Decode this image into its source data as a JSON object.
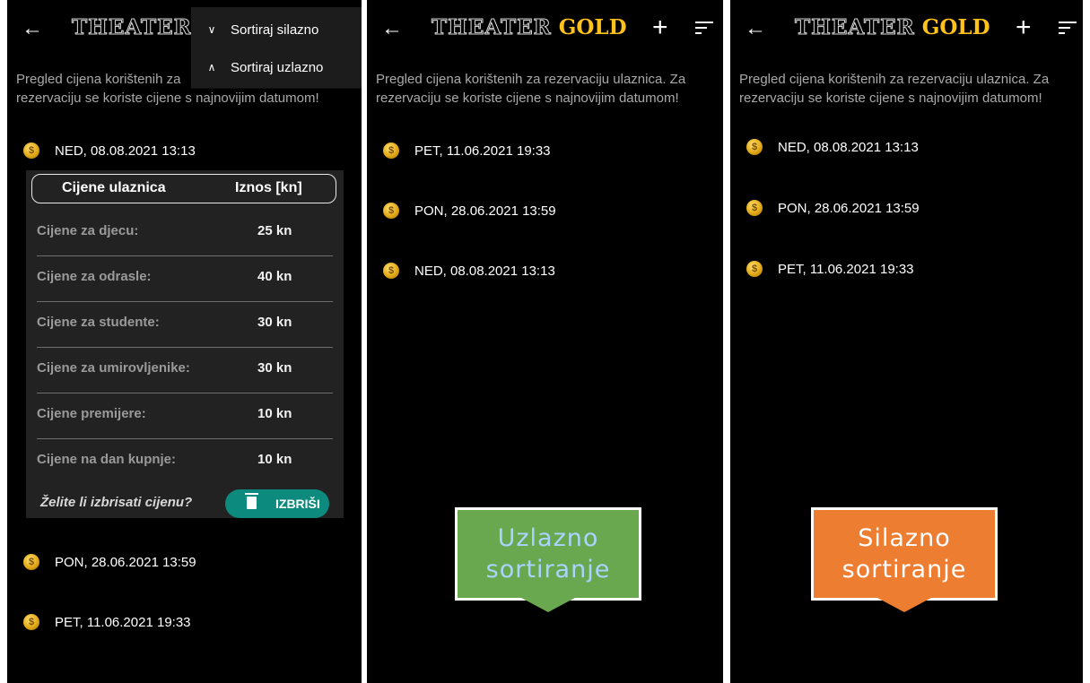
{
  "app": {
    "logo_outline": "THEATER",
    "logo_gold": "GOLD",
    "description": "Pregled cijena korištenih za rezervaciju ulaznica. Za rezervaciju se koriste cijene s najnovijim datumom!",
    "description_short": "Pregled cijena korištenih za",
    "description_line2": "rezervaciju se koriste cijene s najnovijim datumom!"
  },
  "icons": {
    "back": "arrow-left-icon",
    "add": "plus-icon",
    "sort": "sort-icon",
    "coin": "coin-icon",
    "delete": "trash-icon"
  },
  "colors": {
    "background": "#000000",
    "gold": "#ffc21a",
    "delete_button": "#0c8a7d",
    "ascending_callout": "#6aa84f",
    "descending_callout": "#ed7d31"
  },
  "panel1": {
    "menu": {
      "items": [
        {
          "label": "Sortiraj silazno",
          "icon": "chevron-down-icon"
        },
        {
          "label": "Sortiraj uzlazno",
          "icon": "chevron-up-icon"
        }
      ]
    },
    "entries": [
      {
        "label": "NED, 08.08.2021 13:13",
        "expanded": true
      },
      {
        "label": "PON, 28.06.2021 13:59"
      },
      {
        "label": "PET, 11.06.2021 19:33"
      }
    ],
    "card": {
      "col_category": "Cijene ulaznica",
      "col_amount": "Iznos [kn]",
      "rows": [
        {
          "label": "Cijene za djecu:",
          "value": "25 kn"
        },
        {
          "label": "Cijene za odrasle:",
          "value": "40 kn"
        },
        {
          "label": "Cijene za studente:",
          "value": "30 kn"
        },
        {
          "label": "Cijene za umirovljenike:",
          "value": "30 kn"
        },
        {
          "label": "Cijene premijere:",
          "value": "10 kn"
        },
        {
          "label": "Cijene na dan kupnje:",
          "value": "10 kn"
        }
      ],
      "delete_prompt": "Želite li izbrisati cijenu?",
      "delete_label": "IZBRIŠI"
    }
  },
  "panel2": {
    "entries": [
      {
        "label": "PET, 11.06.2021 19:33"
      },
      {
        "label": "PON, 28.06.2021 13:59"
      },
      {
        "label": "NED, 08.08.2021 13:13"
      }
    ],
    "callout": {
      "line1": "Uzlazno",
      "line2": "sortiranje"
    }
  },
  "panel3": {
    "entries": [
      {
        "label": "NED, 08.08.2021 13:13"
      },
      {
        "label": "PON, 28.06.2021 13:59"
      },
      {
        "label": "PET, 11.06.2021 19:33"
      }
    ],
    "callout": {
      "line1": "Silazno",
      "line2": "sortiranje"
    }
  }
}
